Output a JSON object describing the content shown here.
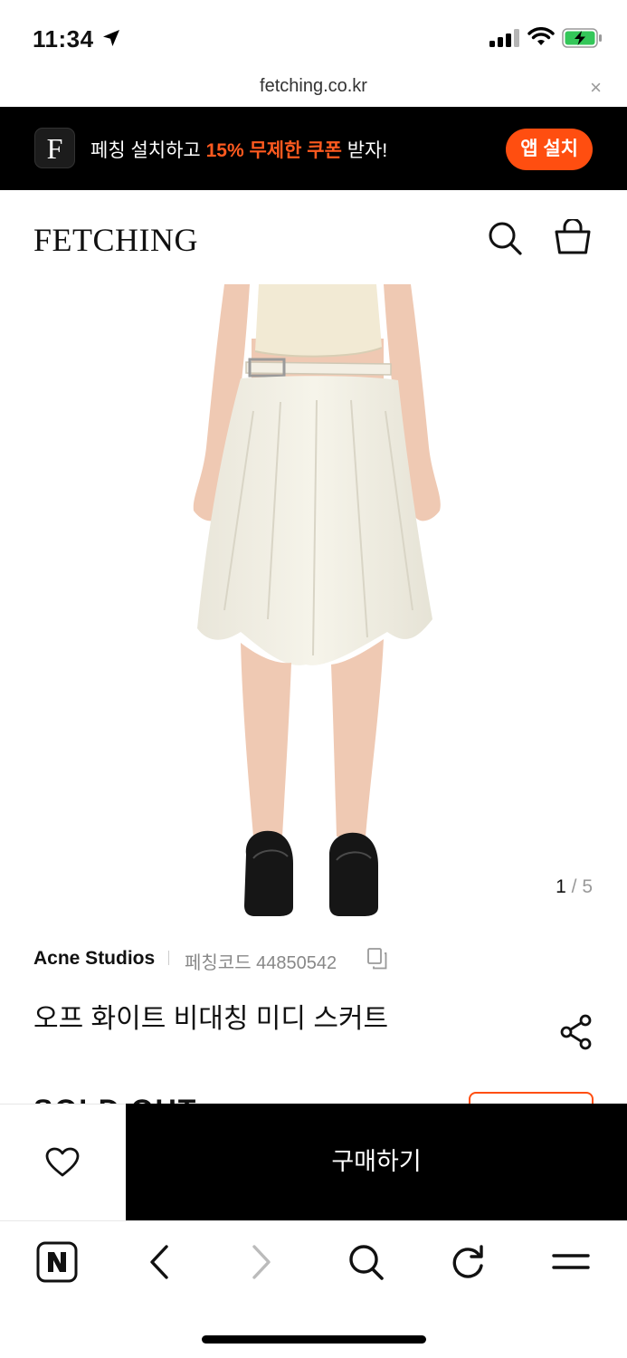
{
  "status_bar": {
    "time": "11:34",
    "icons": [
      "location-arrow-icon",
      "signal-icon",
      "wifi-icon",
      "battery-charging-icon"
    ]
  },
  "url_bar": {
    "url": "fetching.co.kr",
    "close_symbol": "×"
  },
  "app_banner": {
    "logo_letter": "F",
    "text_before": "페칭 설치하고 ",
    "text_highlight": "15% 무제한 쿠폰",
    "text_after": " 받자!",
    "install_label": "앱 설치",
    "accent_color": "#ff4e10"
  },
  "header": {
    "logo": "FETCHING",
    "icons": [
      "search-icon",
      "shopping-bag-icon"
    ]
  },
  "gallery": {
    "current": "1",
    "separator": " / ",
    "total": "5"
  },
  "product": {
    "brand": "Acne Studios",
    "code_label": "페칭코드 44850542",
    "title": "오프 화이트 비대칭 미디 스커트",
    "status_peek": "SOLD OUT"
  },
  "purchase": {
    "buy_label": "구매하기",
    "wish_icon": "heart-icon"
  },
  "browser_toolbar": {
    "icons": [
      "naver-home-icon",
      "back-icon",
      "forward-icon",
      "search-icon",
      "reload-icon",
      "menu-icon"
    ]
  },
  "colors": {
    "accent": "#ff4e10",
    "banner_bg": "#000000",
    "buy_bg": "#000000"
  }
}
